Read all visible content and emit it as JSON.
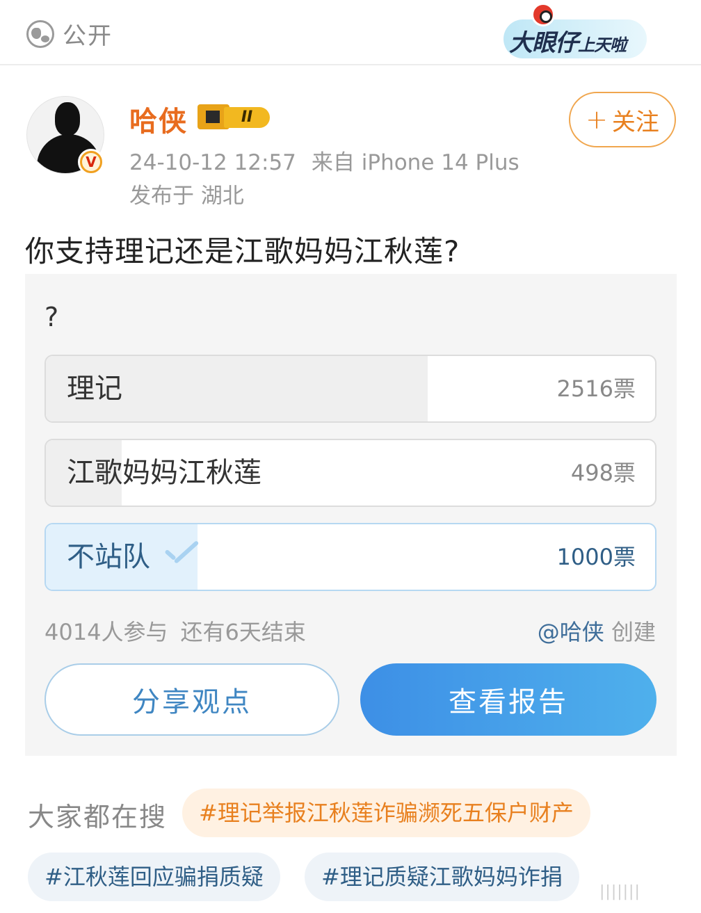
{
  "header": {
    "visibility_label": "公开",
    "badge_text_main": "大眼仔",
    "badge_text_sub": "上天啦"
  },
  "author": {
    "name": "哈侠",
    "level_badge": "II",
    "verified_mark": "V",
    "timestamp": "24-10-12 12:57",
    "source": "来自 iPhone 14 Plus",
    "location": "发布于 湖北",
    "follow_label": "关注",
    "follow_plus": "+"
  },
  "post": {
    "text": "你支持理记还是江歌妈妈江秋莲?"
  },
  "poll": {
    "question": "?",
    "options": [
      {
        "label": "理记",
        "votes": "2516票",
        "share": 0.627,
        "selected": false
      },
      {
        "label": "江歌妈妈江秋莲",
        "votes": "498票",
        "share": 0.124,
        "selected": false
      },
      {
        "label": "不站队",
        "votes": "1000票",
        "share": 0.249,
        "selected": true
      }
    ],
    "participants": "4014人参与",
    "remaining": "还有6天结束",
    "creator_handle": "@哈侠",
    "creator_suffix": "创建",
    "share_label": "分享观点",
    "report_label": "查看报告"
  },
  "trending": {
    "title": "大家都在搜",
    "tags": [
      "#理记举报江秋莲诈骗濒死五保户财产",
      "#江秋莲回应骗捐质疑",
      "#理记质疑江歌妈妈诈捐"
    ]
  },
  "watermark": "|||||||"
}
